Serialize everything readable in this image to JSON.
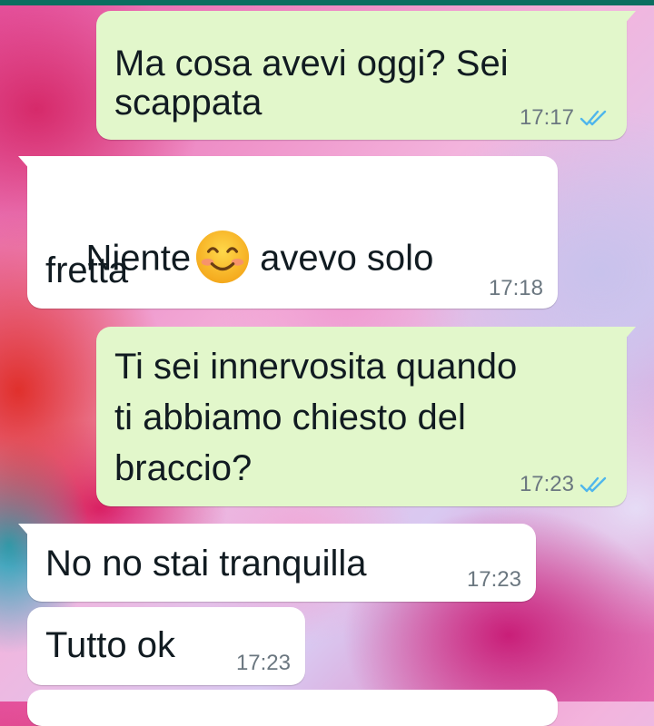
{
  "colors": {
    "outgoing_bubble": "#e2f7cb",
    "incoming_bubble": "#ffffff",
    "read_tick": "#4fb6ec",
    "timestamp": "#6b7780"
  },
  "messages": [
    {
      "direction": "out",
      "line1": "Ma cosa avevi oggi? Sei",
      "line2": "scappata",
      "time": "17:17",
      "status": "read",
      "status_icon": "double-check-icon"
    },
    {
      "direction": "in",
      "before_emoji": "Niente",
      "emoji": "smiling-face-icon",
      "after_emoji": "avevo solo",
      "line2": "fretta",
      "time": "17:18"
    },
    {
      "direction": "out",
      "line1": "Ti sei innervosita quando",
      "line2": "ti abbiamo chiesto del",
      "line3": "braccio?",
      "time": "17:23",
      "status": "read",
      "status_icon": "double-check-icon"
    },
    {
      "direction": "in",
      "text": "No no stai tranquilla",
      "time": "17:23"
    },
    {
      "direction": "in",
      "text": "Tutto ok",
      "time": "17:23"
    }
  ]
}
